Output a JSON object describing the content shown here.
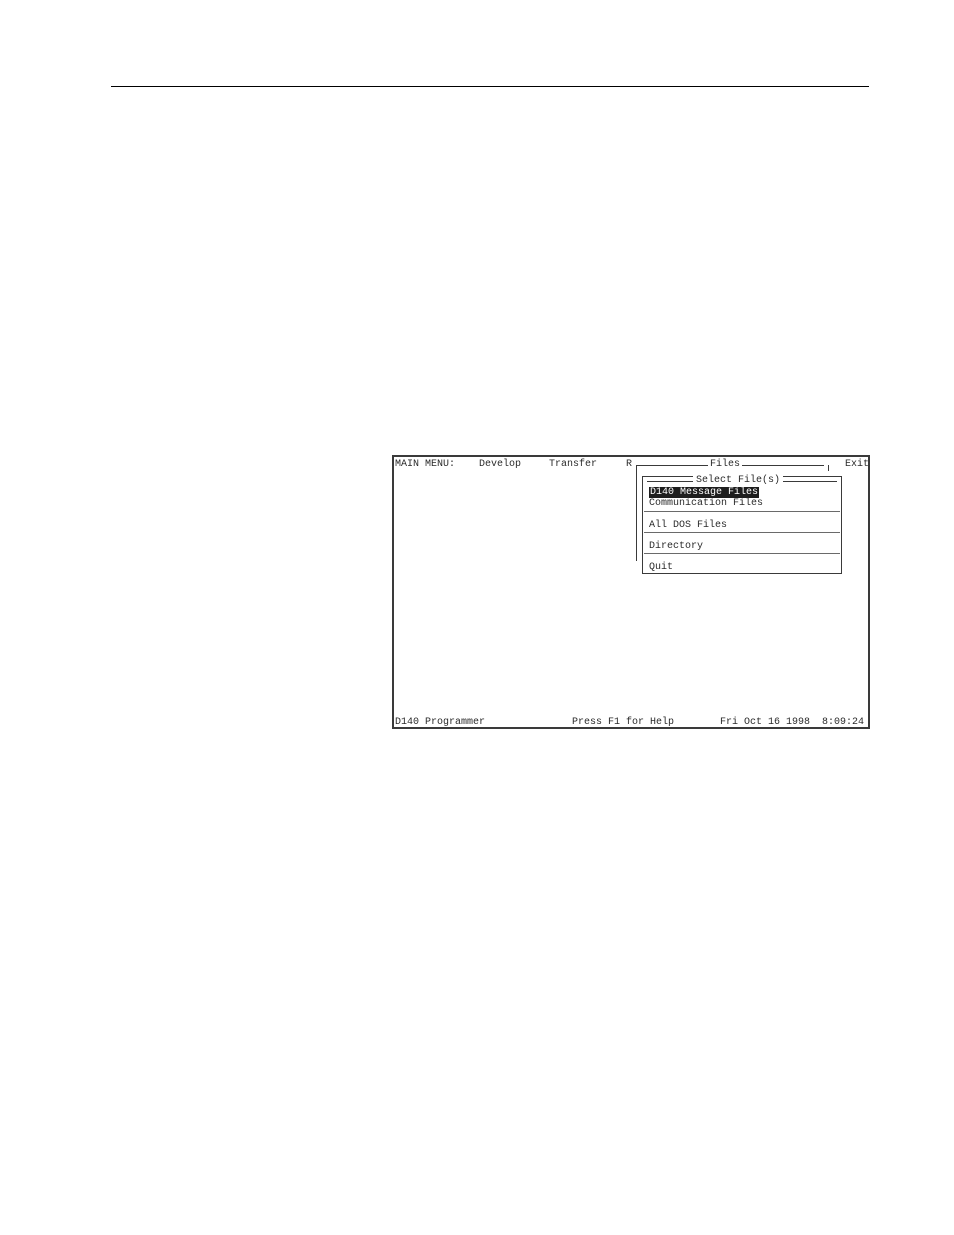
{
  "menu_bar": {
    "label": "MAIN MENU:",
    "items": [
      "Develop",
      "Transfer",
      "R",
      "Exit"
    ]
  },
  "files_menu": {
    "title": "Files",
    "submenu": {
      "title": "Select File(s)",
      "items": [
        "D140 Message Files",
        "Communication Files",
        "All DOS Files",
        "Directory",
        "Quit"
      ],
      "selected": "D140 Message Files"
    }
  },
  "status_bar": {
    "app_name": "D140 Programmer",
    "help": "Press F1 for Help",
    "datetime": "Fri Oct 16 1998  8:09:24"
  },
  "colors": {
    "border": "#3a3a3a",
    "highlight_bg": "#1e1e1e",
    "highlight_fg": "#ffffff"
  }
}
